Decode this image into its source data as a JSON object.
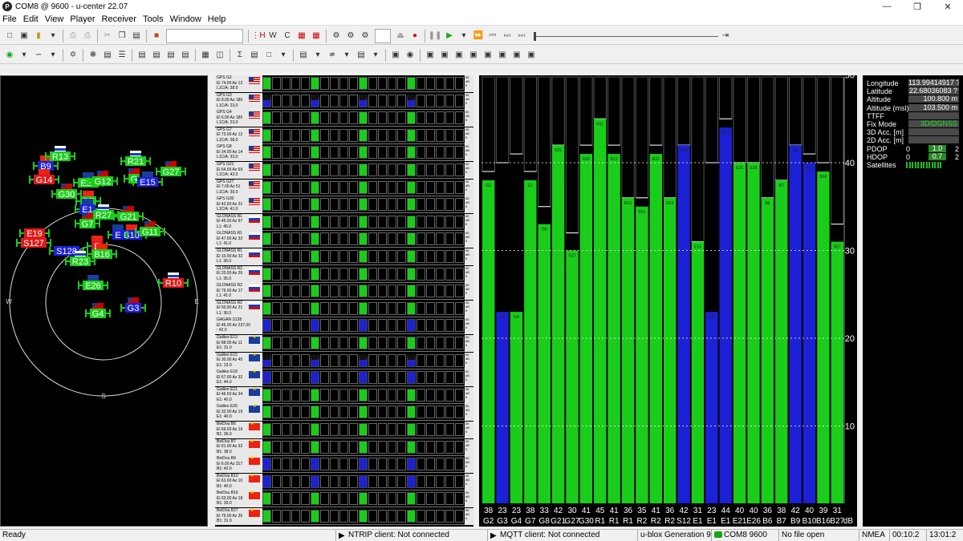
{
  "window": {
    "title": "COM8 @ 9600 - u-center 22.07",
    "app_icon": "P"
  },
  "menu": [
    "File",
    "Edit",
    "View",
    "Player",
    "Receiver",
    "Tools",
    "Window",
    "Help"
  ],
  "satellites": [
    {
      "lines": [
        "GPS G2",
        "El 74.00 Az 12",
        "L1C/A: 38.0"
      ],
      "flag": "us",
      "color": "green",
      "top": false
    },
    {
      "lines": [
        "GPS G3",
        "El 8.00 Az 180",
        "L1C/A: 23.0"
      ],
      "flag": "us",
      "color": "blue",
      "top": true
    },
    {
      "lines": [
        "GPS G4",
        "El 6.00 Az 185",
        "L1C/A: 23.0"
      ],
      "flag": "us",
      "color": "green",
      "top": false
    },
    {
      "lines": [
        "GPS G7",
        "El 73.00 Az 12",
        "L1C/A: 38.0"
      ],
      "flag": "us",
      "color": "green",
      "top": false
    },
    {
      "lines": [
        "GPS G8",
        "El 34.00 Az 14",
        "L1C/A: 33.0"
      ],
      "flag": "us",
      "color": "green",
      "top": false
    },
    {
      "lines": [
        "GPS G21",
        "El 64.00 Az 69",
        "L1C/A: 42.0"
      ],
      "flag": "us",
      "color": "green",
      "top": false
    },
    {
      "lines": [
        "GPS G27",
        "El 7.00 Az 51",
        "L1C/A: 30.0"
      ],
      "flag": "us",
      "color": "green",
      "top": false
    },
    {
      "lines": [
        "GPS G30",
        "El 42.00 Az 31",
        "L1C/A: 41.0"
      ],
      "flag": "us",
      "color": "green",
      "top": false
    },
    {
      "lines": [
        "GLONASS R1",
        "El 45.00 Az 97",
        "L1: 45.0"
      ],
      "flag": "ru",
      "color": "green",
      "top": false
    },
    {
      "lines": [
        "GLONASS R1",
        "El 47.00 Az 32",
        "L1: 41.0"
      ],
      "flag": "ru",
      "color": "green",
      "top": false
    },
    {
      "lines": [
        "GLONASS R1",
        "El 10.00 Az 32",
        "L1: 36.0"
      ],
      "flag": "ru",
      "color": "green",
      "top": false
    },
    {
      "lines": [
        "GLONASS R2",
        "El 20.00 Az 26",
        "L1: 35.0"
      ],
      "flag": "ru",
      "color": "green",
      "top": false
    },
    {
      "lines": [
        "GLONASS R2",
        "El 76.00 Az 17",
        "L1: 41.0"
      ],
      "flag": "ru",
      "color": "green",
      "top": false
    },
    {
      "lines": [
        "GLONASS R2",
        "El 50.00 Az 21",
        "L1: 36.0"
      ],
      "flag": "ru",
      "color": "green",
      "top": false
    },
    {
      "lines": [
        "GAGAN S128",
        "El 46.00 Az 237.00",
        ": 42.0"
      ],
      "flag": "none",
      "color": "blue",
      "top": false
    },
    {
      "lines": [
        "Galileo E13",
        "El 88.00 Az 11",
        "E1: 31.0"
      ],
      "flag": "eu",
      "color": "green",
      "top": false
    },
    {
      "lines": [
        "Galileo E15",
        "El 30.00 Az 45",
        "E1: 23.0"
      ],
      "flag": "eu",
      "color": "blue",
      "top": true
    },
    {
      "lines": [
        "Galileo E18",
        "El 67.00 Az 32",
        "E1: 44.0"
      ],
      "flag": "eu",
      "color": "blue",
      "top": false
    },
    {
      "lines": [
        "Galileo E21",
        "El 46.00 Az 34",
        "E1: 40.0"
      ],
      "flag": "eu",
      "color": "green",
      "top": false
    },
    {
      "lines": [
        "Galileo E26",
        "El 32.00 Az 19",
        "E1: 40.0"
      ],
      "flag": "eu",
      "color": "green",
      "top": false
    },
    {
      "lines": [
        "BeiDou B6",
        "El 69.00 Az 19",
        "B1: 36.0"
      ],
      "flag": "cn",
      "color": "green",
      "top": false
    },
    {
      "lines": [
        "BeiDou B7",
        "El 61.00 Az 32",
        "B1: 38.0"
      ],
      "flag": "cn",
      "color": "green",
      "top": false
    },
    {
      "lines": [
        "BeiDou B9",
        "El 6.00 Az 317",
        "B1: 42.0"
      ],
      "flag": "cn",
      "color": "blue",
      "top": false
    },
    {
      "lines": [
        "BeiDou B10",
        "El 61.00 Az 10",
        "B1: 40.0"
      ],
      "flag": "cn",
      "color": "blue",
      "top": false
    },
    {
      "lines": [
        "BeiDou B16",
        "El 63.00 Az 18",
        "B1: 39.0"
      ],
      "flag": "cn",
      "color": "green",
      "top": false
    },
    {
      "lines": [
        "BeiDou B27",
        "El 79.00 Az 35",
        "B1: 31.0"
      ],
      "flag": "cn",
      "color": "green",
      "top": false
    }
  ],
  "sat_scale": [
    "55",
    "dB",
    "5"
  ],
  "sky_view": {
    "compass": [
      "N",
      "E",
      "W",
      "S"
    ],
    "sats": [
      {
        "label": "B9",
        "x": 56,
        "y": 206,
        "color": "blue",
        "flag": "cn"
      },
      {
        "label": "R13",
        "x": 74,
        "y": 194,
        "color": "green",
        "flag": "ru"
      },
      {
        "label": "R21",
        "x": 168,
        "y": 200,
        "color": "green",
        "flag": "ru"
      },
      {
        "label": "G27",
        "x": 212,
        "y": 213,
        "color": "green",
        "flag": "us"
      },
      {
        "label": "G14",
        "x": 54,
        "y": 223,
        "color": "red",
        "flag": "cn"
      },
      {
        "label": "E21",
        "x": 109,
        "y": 227,
        "color": "green",
        "flag": "eu"
      },
      {
        "label": "G12",
        "x": 127,
        "y": 225,
        "color": "green",
        "flag": "us"
      },
      {
        "label": "G",
        "x": 166,
        "y": 222,
        "color": "green",
        "flag": "us"
      },
      {
        "label": "E15",
        "x": 183,
        "y": 226,
        "color": "blue",
        "flag": "eu"
      },
      {
        "label": "G30",
        "x": 82,
        "y": 241,
        "color": "green",
        "flag": "us"
      },
      {
        "label": "B7",
        "x": 109,
        "y": 250,
        "color": "green",
        "flag": "cn"
      },
      {
        "label": "E1",
        "x": 108,
        "y": 260,
        "color": "blue",
        "flag": "eu"
      },
      {
        "label": "G21",
        "x": 159,
        "y": 269,
        "color": "green",
        "flag": "us"
      },
      {
        "label": "R27",
        "x": 128,
        "y": 267,
        "color": "green",
        "flag": "ru"
      },
      {
        "label": "G7",
        "x": 108,
        "y": 278,
        "color": "green",
        "flag": "us"
      },
      {
        "label": "E19",
        "x": 42,
        "y": 290,
        "color": "red",
        "flag": "none"
      },
      {
        "label": "S127",
        "x": 41,
        "y": 302,
        "color": "red",
        "flag": "none"
      },
      {
        "label": "B10",
        "x": 163,
        "y": 292,
        "color": "blue",
        "flag": "cn"
      },
      {
        "label": "E",
        "x": 146,
        "y": 292,
        "color": "blue",
        "flag": "eu"
      },
      {
        "label": "G11",
        "x": 186,
        "y": 288,
        "color": "green",
        "flag": "us"
      },
      {
        "label": "E",
        "x": 120,
        "y": 306,
        "color": "red",
        "flag": "cn"
      },
      {
        "label": "S128",
        "x": 82,
        "y": 312,
        "color": "blue",
        "flag": "none"
      },
      {
        "label": "B16",
        "x": 126,
        "y": 316,
        "color": "green",
        "flag": "cn"
      },
      {
        "label": "R23",
        "x": 99,
        "y": 325,
        "color": "green",
        "flag": "ru"
      },
      {
        "label": "R10",
        "x": 215,
        "y": 352,
        "color": "red",
        "flag": "ru"
      },
      {
        "label": "E26",
        "x": 115,
        "y": 355,
        "color": "green",
        "flag": "eu"
      },
      {
        "label": "G4",
        "x": 121,
        "y": 390,
        "color": "green",
        "flag": "us"
      },
      {
        "label": "G3",
        "x": 165,
        "y": 383,
        "color": "blue",
        "flag": "us"
      }
    ]
  },
  "chart_data": {
    "type": "bar",
    "categories": [
      "G2",
      "G3",
      "G4",
      "G7",
      "G8",
      "G21",
      "G27",
      "G30",
      "R1",
      "R12",
      "R13",
      "R21",
      "R22",
      "R23",
      "S128",
      "E13",
      "E15",
      "E18",
      "E21",
      "E26",
      "B6",
      "B7",
      "B9",
      "B10",
      "B16",
      "B27"
    ],
    "axis_labels": [
      "G2",
      "G3",
      "G4",
      "G7",
      "G8",
      "G21",
      "G27",
      "G30",
      "R1",
      "R1",
      "R1",
      "R2",
      "R2",
      "R2",
      "S12",
      "E1",
      "E1",
      "E1",
      "E21",
      "E26",
      "B6",
      "B7",
      "B9",
      "B10",
      "B16",
      "B27"
    ],
    "values": [
      38,
      23,
      23,
      38,
      33,
      42,
      30,
      41,
      45,
      41,
      36,
      35,
      41,
      36,
      42,
      31,
      23,
      44,
      40,
      40,
      36,
      38,
      42,
      40,
      39,
      31
    ],
    "maxima": [
      39,
      40,
      41,
      39,
      35,
      42,
      32,
      42,
      45,
      42,
      36,
      36,
      42,
      36,
      42,
      31,
      40,
      45,
      40,
      40,
      36,
      38,
      42,
      41,
      40,
      33
    ],
    "colors": [
      "green",
      "blue",
      "green",
      "green",
      "green",
      "green",
      "green",
      "green",
      "green",
      "green",
      "green",
      "green",
      "green",
      "green",
      "blue",
      "green",
      "blue",
      "blue",
      "green",
      "green",
      "green",
      "green",
      "blue",
      "blue",
      "green",
      "green"
    ],
    "bar_tags": [
      "G2",
      "G3",
      "G4",
      "G7",
      "G8",
      "G21",
      "G27",
      "G30",
      "R11",
      "R12",
      "R13",
      "R21",
      "R22",
      "R23",
      "S128",
      "E13",
      "E15",
      "E18",
      "E21",
      "E26",
      "B6",
      "B7",
      "B9",
      "B10",
      "B16",
      "B27"
    ],
    "ylim": [
      0,
      55
    ],
    "yticks": [
      10,
      20,
      30,
      40,
      50
    ],
    "unit_label": "dB",
    "grid": true,
    "palette": {
      "green": "#1acd1a",
      "blue": "#1c21d6",
      "bg": "#000000"
    }
  },
  "data_view": [
    {
      "label": "Longitude",
      "value": "113.99414917 ?"
    },
    {
      "label": "Latitude",
      "value": "22.68036083 ?"
    },
    {
      "label": "Altitude",
      "value": "100.800 m"
    },
    {
      "label": "Altitude (msl)",
      "value": "103.500 m"
    },
    {
      "label": "TTFF",
      "value": ""
    },
    {
      "label": "Fix Mode",
      "value": "3D/DGNSS",
      "fix": true
    },
    {
      "label": "3D Acc. [m]",
      "value": ""
    },
    {
      "label": "2D Acc. [m]",
      "value": ""
    }
  ],
  "dop": [
    {
      "label": "PDOP",
      "lo": "0",
      "val": "1.0",
      "hi": "2"
    },
    {
      "label": "HDOP",
      "lo": "0",
      "val": "0.7",
      "hi": "2"
    }
  ],
  "satellites_label": "Satellites",
  "satellites_bars": 13,
  "status": {
    "ready": "Ready",
    "ntrip": "NTRIP client: Not connected",
    "mqtt": "MQTT client: Not connected",
    "generation": "u-blox Generation 9",
    "port": "COM8 9600",
    "file": "No file open",
    "protocol": "NMEA",
    "time1": "00:10:2",
    "time2": "13:01:2"
  }
}
